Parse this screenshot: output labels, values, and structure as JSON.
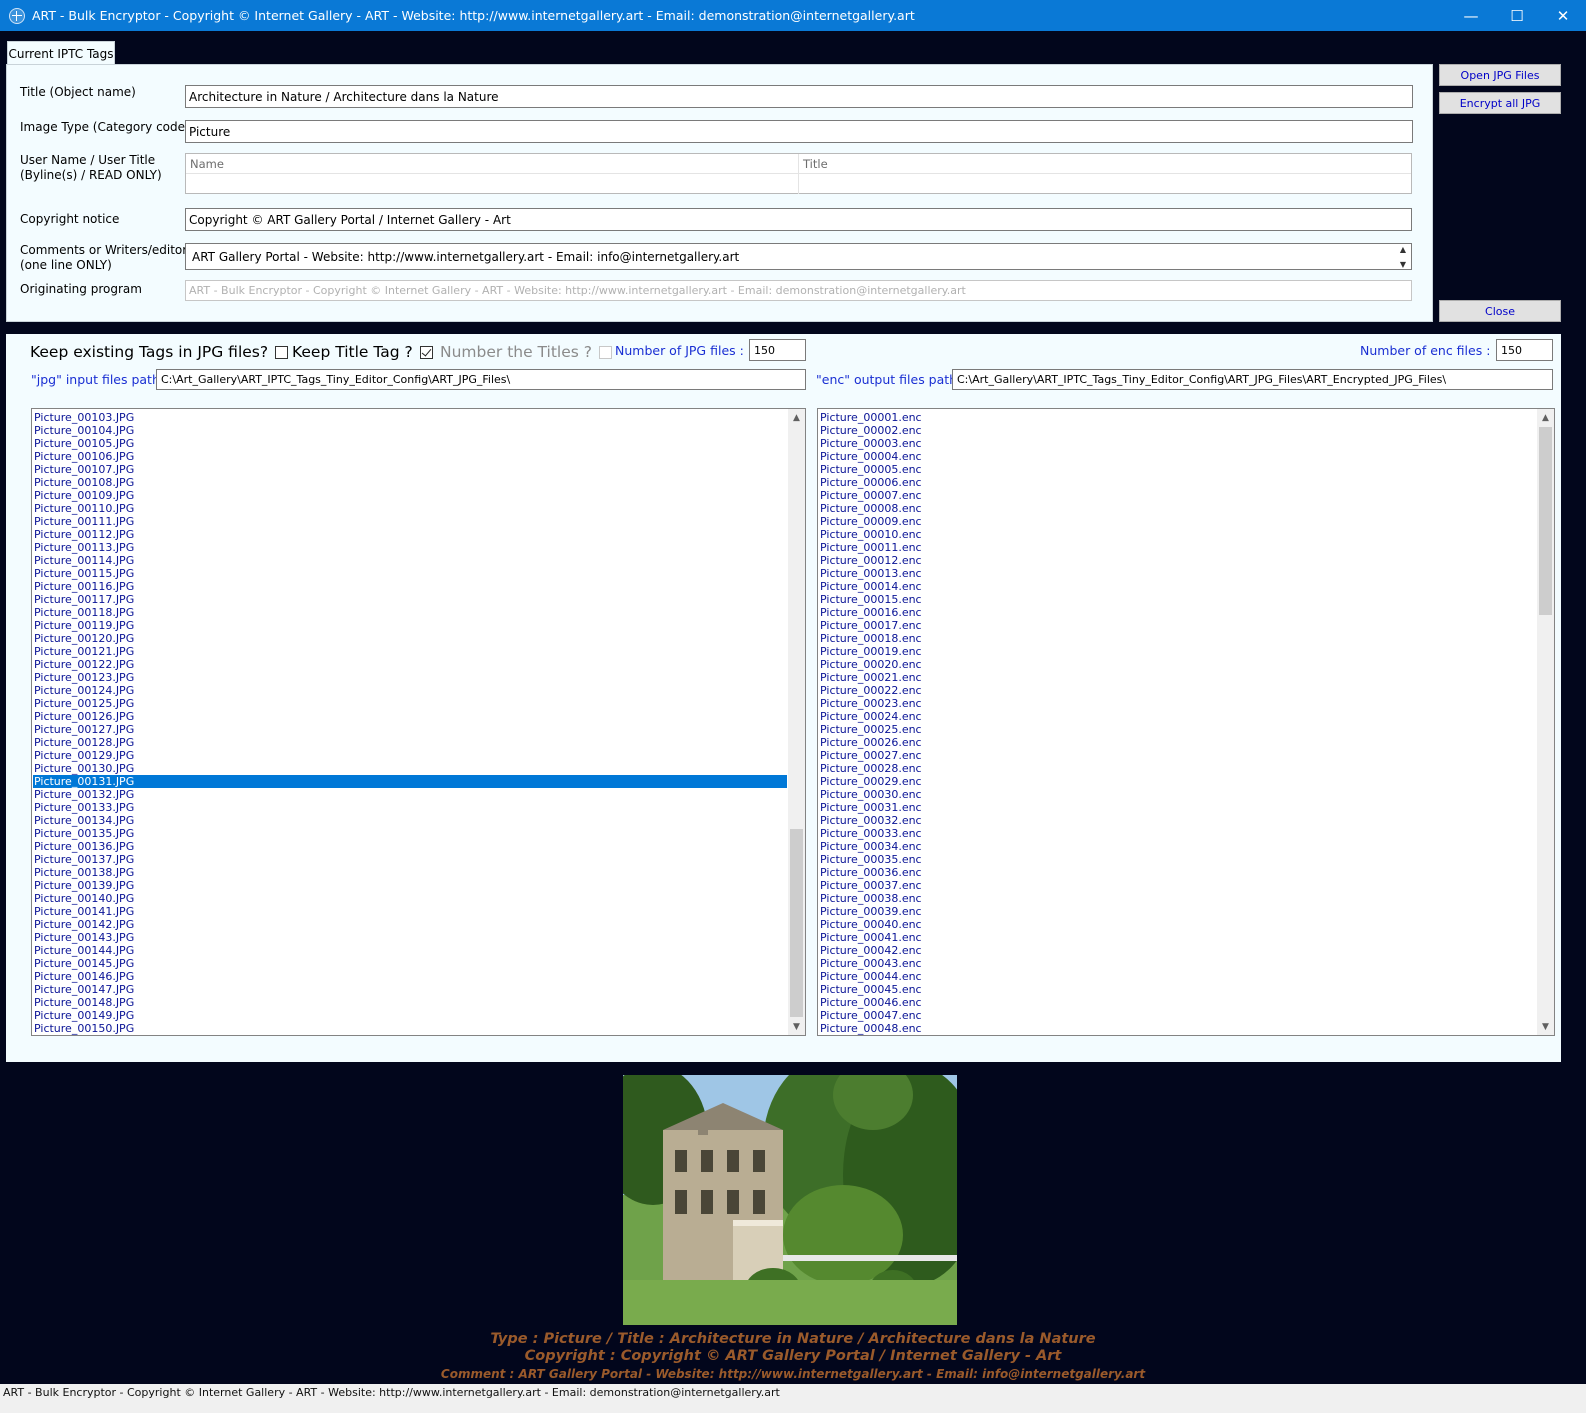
{
  "window": {
    "title": "ART - Bulk Encryptor - Copyright © Internet Gallery - ART - Website: http://www.internetgallery.art - Email: demonstration@internetgallery.art",
    "minimize": "—",
    "maximize": "☐",
    "close": "✕"
  },
  "tab": {
    "label": "Current IPTC Tags"
  },
  "tags": {
    "title_label": "Title (Object name)",
    "title_value": "Architecture in Nature / Architecture dans la Nature",
    "type_label": "Image Type (Category code)",
    "type_value": "Picture",
    "byline_label_1": "User Name / User Title",
    "byline_label_2": "(Byline(s) / READ ONLY)",
    "byline_col_name": "Name",
    "byline_col_title": "Title",
    "copyright_label": "Copyright notice",
    "copyright_value": "Copyright © ART Gallery Portal / Internet Gallery - Art",
    "comments_label_1": "Comments or Writers/editors",
    "comments_label_2": "(one line ONLY)",
    "comments_value": "ART Gallery Portal - Website: http://www.internetgallery.art - Email: info@internetgallery.art",
    "program_label": "Originating program",
    "program_value": "ART - Bulk Encryptor - Copyright © Internet Gallery - ART - Website: http://www.internetgallery.art - Email: demonstration@internetgallery.art"
  },
  "buttons": {
    "open": "Open JPG Files",
    "encrypt": "Encrypt all JPG",
    "close": "Close"
  },
  "options": {
    "keep_existing": "Keep existing Tags in JPG files?",
    "keep_existing_checked": false,
    "keep_title": "Keep Title Tag ?",
    "keep_title_checked": true,
    "number_titles": "Number the Titles ?",
    "number_titles_checked": false
  },
  "counts": {
    "jpg_label": "Number of JPG files :",
    "jpg_value": "150",
    "enc_label": "Number of enc files :",
    "enc_value": "150"
  },
  "paths": {
    "input_label": "\"jpg\" input files path :",
    "input_value": "C:\\Art_Gallery\\ART_IPTC_Tags_Tiny_Editor_Config\\ART_JPG_Files\\",
    "output_label": "\"enc\" output files path :",
    "output_value": "C:\\Art_Gallery\\ART_IPTC_Tags_Tiny_Editor_Config\\ART_JPG_Files\\ART_Encrypted_JPG_Files\\"
  },
  "jpg_list": {
    "selected": "Picture_00131.JPG",
    "items": [
      "Picture_00103.JPG",
      "Picture_00104.JPG",
      "Picture_00105.JPG",
      "Picture_00106.JPG",
      "Picture_00107.JPG",
      "Picture_00108.JPG",
      "Picture_00109.JPG",
      "Picture_00110.JPG",
      "Picture_00111.JPG",
      "Picture_00112.JPG",
      "Picture_00113.JPG",
      "Picture_00114.JPG",
      "Picture_00115.JPG",
      "Picture_00116.JPG",
      "Picture_00117.JPG",
      "Picture_00118.JPG",
      "Picture_00119.JPG",
      "Picture_00120.JPG",
      "Picture_00121.JPG",
      "Picture_00122.JPG",
      "Picture_00123.JPG",
      "Picture_00124.JPG",
      "Picture_00125.JPG",
      "Picture_00126.JPG",
      "Picture_00127.JPG",
      "Picture_00128.JPG",
      "Picture_00129.JPG",
      "Picture_00130.JPG",
      "Picture_00131.JPG",
      "Picture_00132.JPG",
      "Picture_00133.JPG",
      "Picture_00134.JPG",
      "Picture_00135.JPG",
      "Picture_00136.JPG",
      "Picture_00137.JPG",
      "Picture_00138.JPG",
      "Picture_00139.JPG",
      "Picture_00140.JPG",
      "Picture_00141.JPG",
      "Picture_00142.JPG",
      "Picture_00143.JPG",
      "Picture_00144.JPG",
      "Picture_00145.JPG",
      "Picture_00146.JPG",
      "Picture_00147.JPG",
      "Picture_00148.JPG",
      "Picture_00149.JPG",
      "Picture_00150.JPG"
    ]
  },
  "enc_list": {
    "items": [
      "Picture_00001.enc",
      "Picture_00002.enc",
      "Picture_00003.enc",
      "Picture_00004.enc",
      "Picture_00005.enc",
      "Picture_00006.enc",
      "Picture_00007.enc",
      "Picture_00008.enc",
      "Picture_00009.enc",
      "Picture_00010.enc",
      "Picture_00011.enc",
      "Picture_00012.enc",
      "Picture_00013.enc",
      "Picture_00014.enc",
      "Picture_00015.enc",
      "Picture_00016.enc",
      "Picture_00017.enc",
      "Picture_00018.enc",
      "Picture_00019.enc",
      "Picture_00020.enc",
      "Picture_00021.enc",
      "Picture_00022.enc",
      "Picture_00023.enc",
      "Picture_00024.enc",
      "Picture_00025.enc",
      "Picture_00026.enc",
      "Picture_00027.enc",
      "Picture_00028.enc",
      "Picture_00029.enc",
      "Picture_00030.enc",
      "Picture_00031.enc",
      "Picture_00032.enc",
      "Picture_00033.enc",
      "Picture_00034.enc",
      "Picture_00035.enc",
      "Picture_00036.enc",
      "Picture_00037.enc",
      "Picture_00038.enc",
      "Picture_00039.enc",
      "Picture_00040.enc",
      "Picture_00041.enc",
      "Picture_00042.enc",
      "Picture_00043.enc",
      "Picture_00044.enc",
      "Picture_00045.enc",
      "Picture_00046.enc",
      "Picture_00047.enc",
      "Picture_00048.enc"
    ]
  },
  "preview": {
    "caption_type": "Type : Picture / Title : Architecture in Nature / Architecture dans la Nature",
    "caption_copyright": "Copyright : Copyright © ART Gallery Portal / Internet Gallery - Art",
    "caption_comment": "Comment : ART Gallery Portal - Website: http://www.internetgallery.art - Email: info@internetgallery.art"
  },
  "status": {
    "text": "ART - Bulk Encryptor - Copyright © Internet Gallery - ART - Website: http://www.internetgallery.art - Email: demonstration@internetgallery.art"
  },
  "colors": {
    "titlebar": "#0a79d6",
    "background": "#02061c",
    "panel": "#f3fcff",
    "selection": "#0078d7",
    "list_text": "#0a1496",
    "caption": "#9a5a2b"
  }
}
